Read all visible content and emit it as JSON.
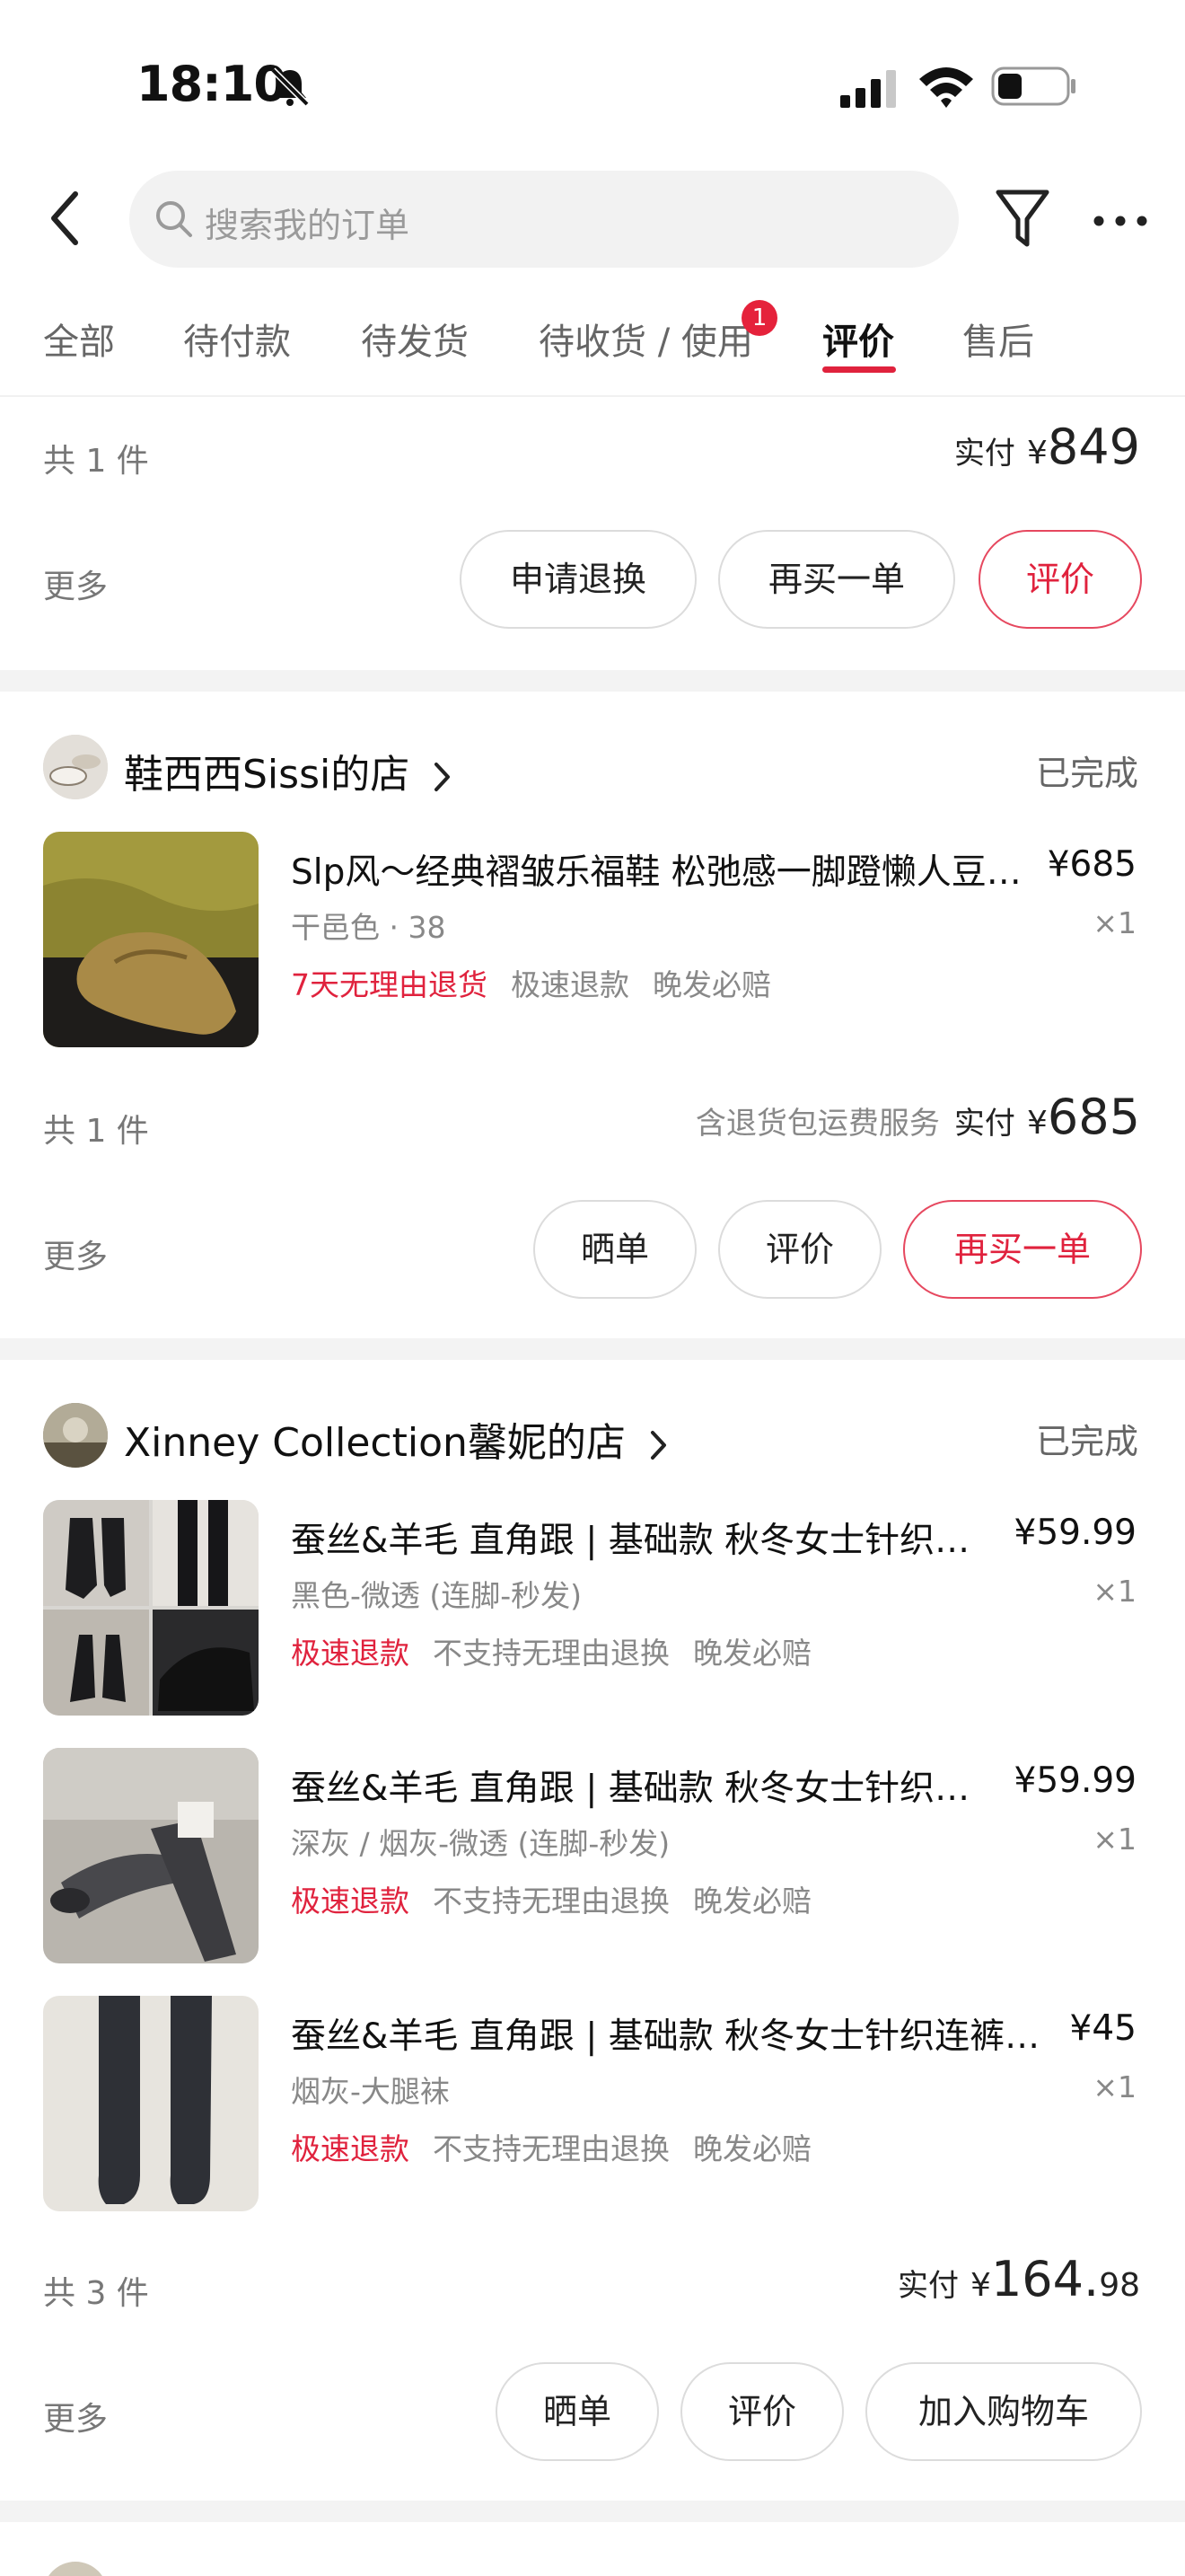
{
  "status_bar": {
    "time": "18:10"
  },
  "search": {
    "placeholder": "搜索我的订单"
  },
  "tabs": [
    {
      "label": "全部"
    },
    {
      "label": "待付款"
    },
    {
      "label": "待发货"
    },
    {
      "label": "待收货 / 使用",
      "badge": "1"
    },
    {
      "label": "评价",
      "active": true
    },
    {
      "label": "售后"
    }
  ],
  "orders": [
    {
      "count": "共 1 件",
      "paid_label": "实付",
      "currency": "¥",
      "amount": "849",
      "more": "更多",
      "buttons": [
        "申请退换",
        "再买一单",
        "评价"
      ]
    },
    {
      "shop": "鞋西西Sissi的店",
      "status": "已完成",
      "items": [
        {
          "title": "Slp风～经典褶皱乐福鞋 松弛感一脚蹬懒人豆豆鞋",
          "price": "¥685",
          "spec": "干邑色 · 38",
          "qty": "×1",
          "tags": [
            {
              "text": "7天无理由退货",
              "color": "#e0223d"
            },
            {
              "text": "极速退款",
              "color": "#888888"
            },
            {
              "text": "晚发必赔",
              "color": "#888888"
            }
          ]
        }
      ],
      "count": "共 1 件",
      "note": "含退货包运费服务",
      "paid_label": "实付",
      "currency": "¥",
      "amount": "685",
      "more": "更多",
      "buttons": [
        "晒单",
        "评价",
        "再买一单"
      ]
    },
    {
      "shop": "Xinney Collection馨妮的店",
      "status": "已完成",
      "items": [
        {
          "title": "蚕丝&羊毛 直角跟 | 基础款 秋冬女士针织连裤袜",
          "price": "¥59.99",
          "spec": "黑色-微透 (连脚-秒发)",
          "qty": "×1",
          "tags": [
            {
              "text": "极速退款",
              "color": "#e0223d"
            },
            {
              "text": "不支持无理由退换",
              "color": "#888888"
            },
            {
              "text": "晚发必赔",
              "color": "#888888"
            }
          ]
        },
        {
          "title": "蚕丝&羊毛 直角跟 | 基础款 秋冬女士针织连裤袜",
          "price": "¥59.99",
          "spec": "深灰 / 烟灰-微透 (连脚-秒发)",
          "qty": "×1",
          "tags": [
            {
              "text": "极速退款",
              "color": "#e0223d"
            },
            {
              "text": "不支持无理由退换",
              "color": "#888888"
            },
            {
              "text": "晚发必赔",
              "color": "#888888"
            }
          ]
        },
        {
          "title": "蚕丝&羊毛 直角跟 | 基础款 秋冬女士针织连裤大腿袜",
          "price": "¥45",
          "spec": "烟灰-大腿袜",
          "qty": "×1",
          "tags": [
            {
              "text": "极速退款",
              "color": "#e0223d"
            },
            {
              "text": "不支持无理由退换",
              "color": "#888888"
            },
            {
              "text": "晚发必赔",
              "color": "#888888"
            }
          ]
        }
      ],
      "count": "共 3 件",
      "paid_label": "实付",
      "currency": "¥",
      "amount": "164.",
      "amount_decimal": "98",
      "more": "更多",
      "buttons": [
        "晒单",
        "评价",
        "加入购物车"
      ]
    }
  ],
  "colors": {
    "accent": "#e0223d",
    "muted": "#888888",
    "divider": "#f3f3f3"
  }
}
